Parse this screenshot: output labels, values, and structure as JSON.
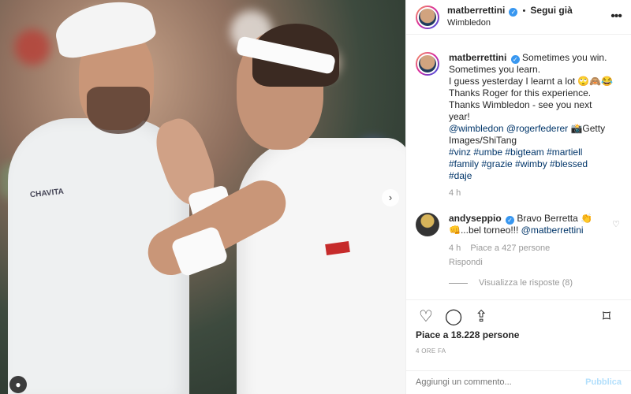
{
  "post": {
    "author": "matberrettini",
    "follow_label": "Segui già",
    "location": "Wimbledon",
    "caption": {
      "line1": "Sometimes you win.",
      "line2": "Sometimes you learn.",
      "line3": "I guess yesterday I learnt a lot 🙄🙈😂",
      "line4": "Thanks Roger for this experience.",
      "line5": "Thanks Wimbledon - see you next",
      "line6": "year!",
      "mention1": "@wimbledon",
      "mention2": "@rogerfederer",
      "credit": "📸Getty Images/ShiTang",
      "hashtags_line1": "#vinz #umbe #bigteam #martiell",
      "hashtags_line2": "#family #grazie #wimby #blessed",
      "hashtags_line3": "#daje",
      "time": "4 h"
    },
    "reply": {
      "author": "andyseppio",
      "text": "Bravo Berretta 👏",
      "text2": "👊...bel torneo!!!",
      "mention": "@matberrettini",
      "time": "4 h",
      "likes": "Piace a 427 persone",
      "reply_label": "Rispondi"
    },
    "view_replies": "Visualizza le risposte (8)",
    "likes": "Piace a 18.228 persone",
    "time_ago": "4 ORE FA",
    "comment_placeholder": "Aggiungi un commento...",
    "publish_label": "Pubblica"
  },
  "photo": {
    "brand_text": "CHAVITA"
  },
  "icons": {
    "verified": "verified-badge-icon",
    "more": "more-options-icon",
    "heart": "heart-icon",
    "comment": "comment-icon",
    "share": "share-icon",
    "bookmark": "bookmark-icon",
    "next": "carousel-next-icon",
    "user_tag": "user-tag-icon"
  },
  "colors": {
    "link": "#003569",
    "verified": "#3897f0",
    "muted": "#999999",
    "publish": "#b2dffc"
  }
}
